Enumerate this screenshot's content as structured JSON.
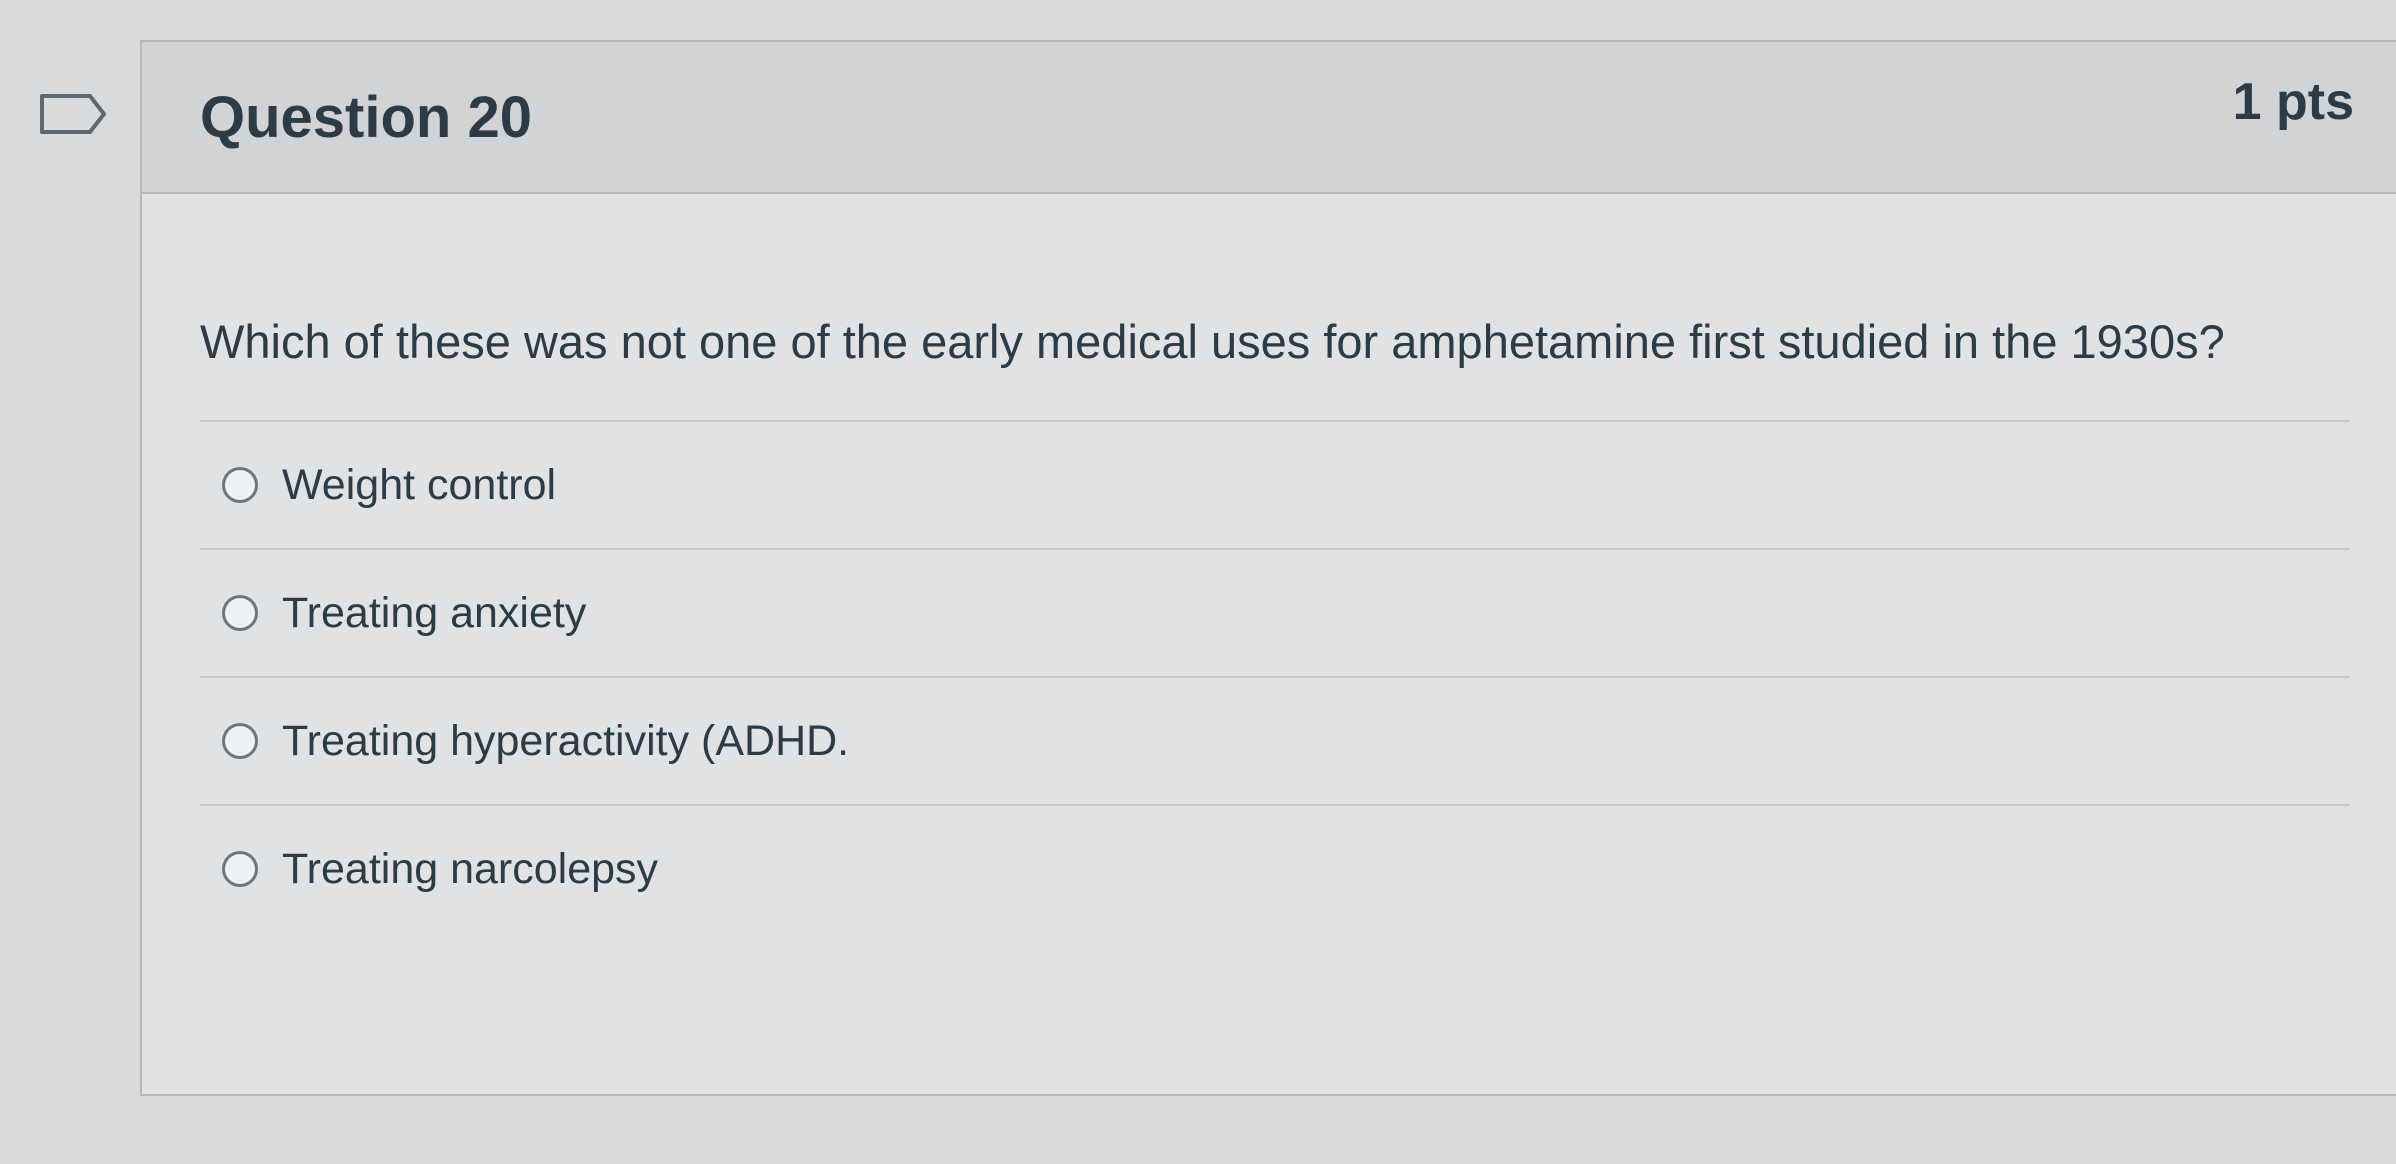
{
  "question": {
    "title": "Question 20",
    "points": "1 pts",
    "text": "Which of these was not one of the early medical uses for amphetamine first studied in the 1930s?",
    "flag_icon": "flag-outline-icon"
  },
  "answers": [
    {
      "label": "Weight control",
      "selected": false
    },
    {
      "label": "Treating anxiety",
      "selected": false
    },
    {
      "label": "Treating hyperactivity (ADHD.",
      "selected": false
    },
    {
      "label": "Treating narcolepsy",
      "selected": false
    }
  ],
  "colors": {
    "text": "#2d3b45",
    "header_bg": "#d2d3d4",
    "body_bg": "#e1e2e3",
    "border": "#b4b6b8"
  }
}
